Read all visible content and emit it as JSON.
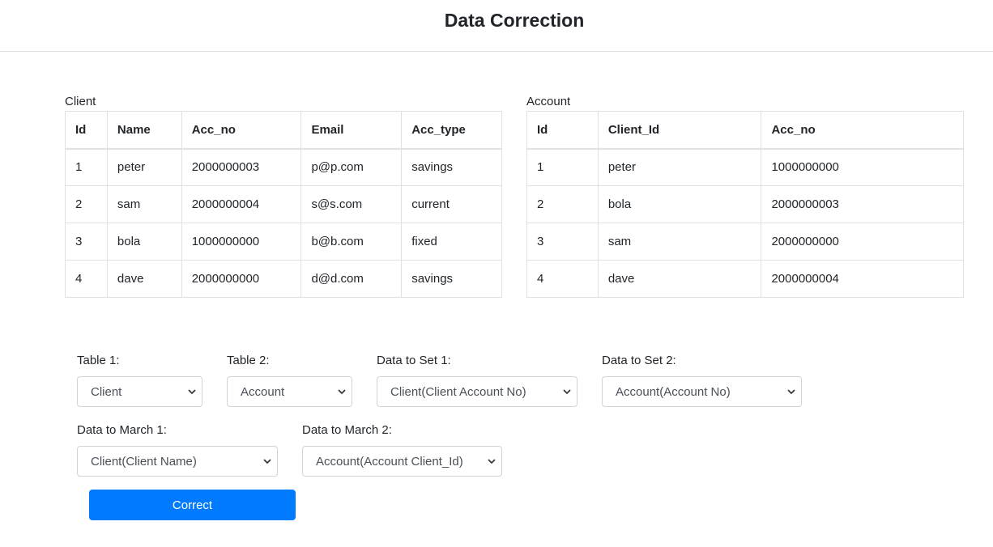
{
  "header": {
    "title": "Data Correction"
  },
  "client_table": {
    "caption": "Client",
    "columns": [
      "Id",
      "Name",
      "Acc_no",
      "Email",
      "Acc_type"
    ],
    "rows": [
      [
        "1",
        "peter",
        "2000000003",
        "p@p.com",
        "savings"
      ],
      [
        "2",
        "sam",
        "2000000004",
        "s@s.com",
        "current"
      ],
      [
        "3",
        "bola",
        "1000000000",
        "b@b.com",
        "fixed"
      ],
      [
        "4",
        "dave",
        "2000000000",
        "d@d.com",
        "savings"
      ]
    ]
  },
  "account_table": {
    "caption": "Account",
    "columns": [
      "Id",
      "Client_Id",
      "Acc_no"
    ],
    "rows": [
      [
        "1",
        "peter",
        "1000000000"
      ],
      [
        "2",
        "bola",
        "2000000003"
      ],
      [
        "3",
        "sam",
        "2000000000"
      ],
      [
        "4",
        "dave",
        "2000000004"
      ]
    ]
  },
  "form": {
    "table1": {
      "label": "Table 1:",
      "value": "Client"
    },
    "table2": {
      "label": "Table 2:",
      "value": "Account"
    },
    "set1": {
      "label": "Data to Set 1:",
      "value": "Client(Client Account No)"
    },
    "set2": {
      "label": "Data to Set 2:",
      "value": "Account(Account No)"
    },
    "match1": {
      "label": "Data to March 1:",
      "value": "Client(Client Name)"
    },
    "match2": {
      "label": "Data to March 2:",
      "value": "Account(Account Client_Id)"
    },
    "submit_label": "Correct"
  },
  "colors": {
    "primary": "#007bff",
    "border": "#dee2e6",
    "text": "#212529"
  }
}
